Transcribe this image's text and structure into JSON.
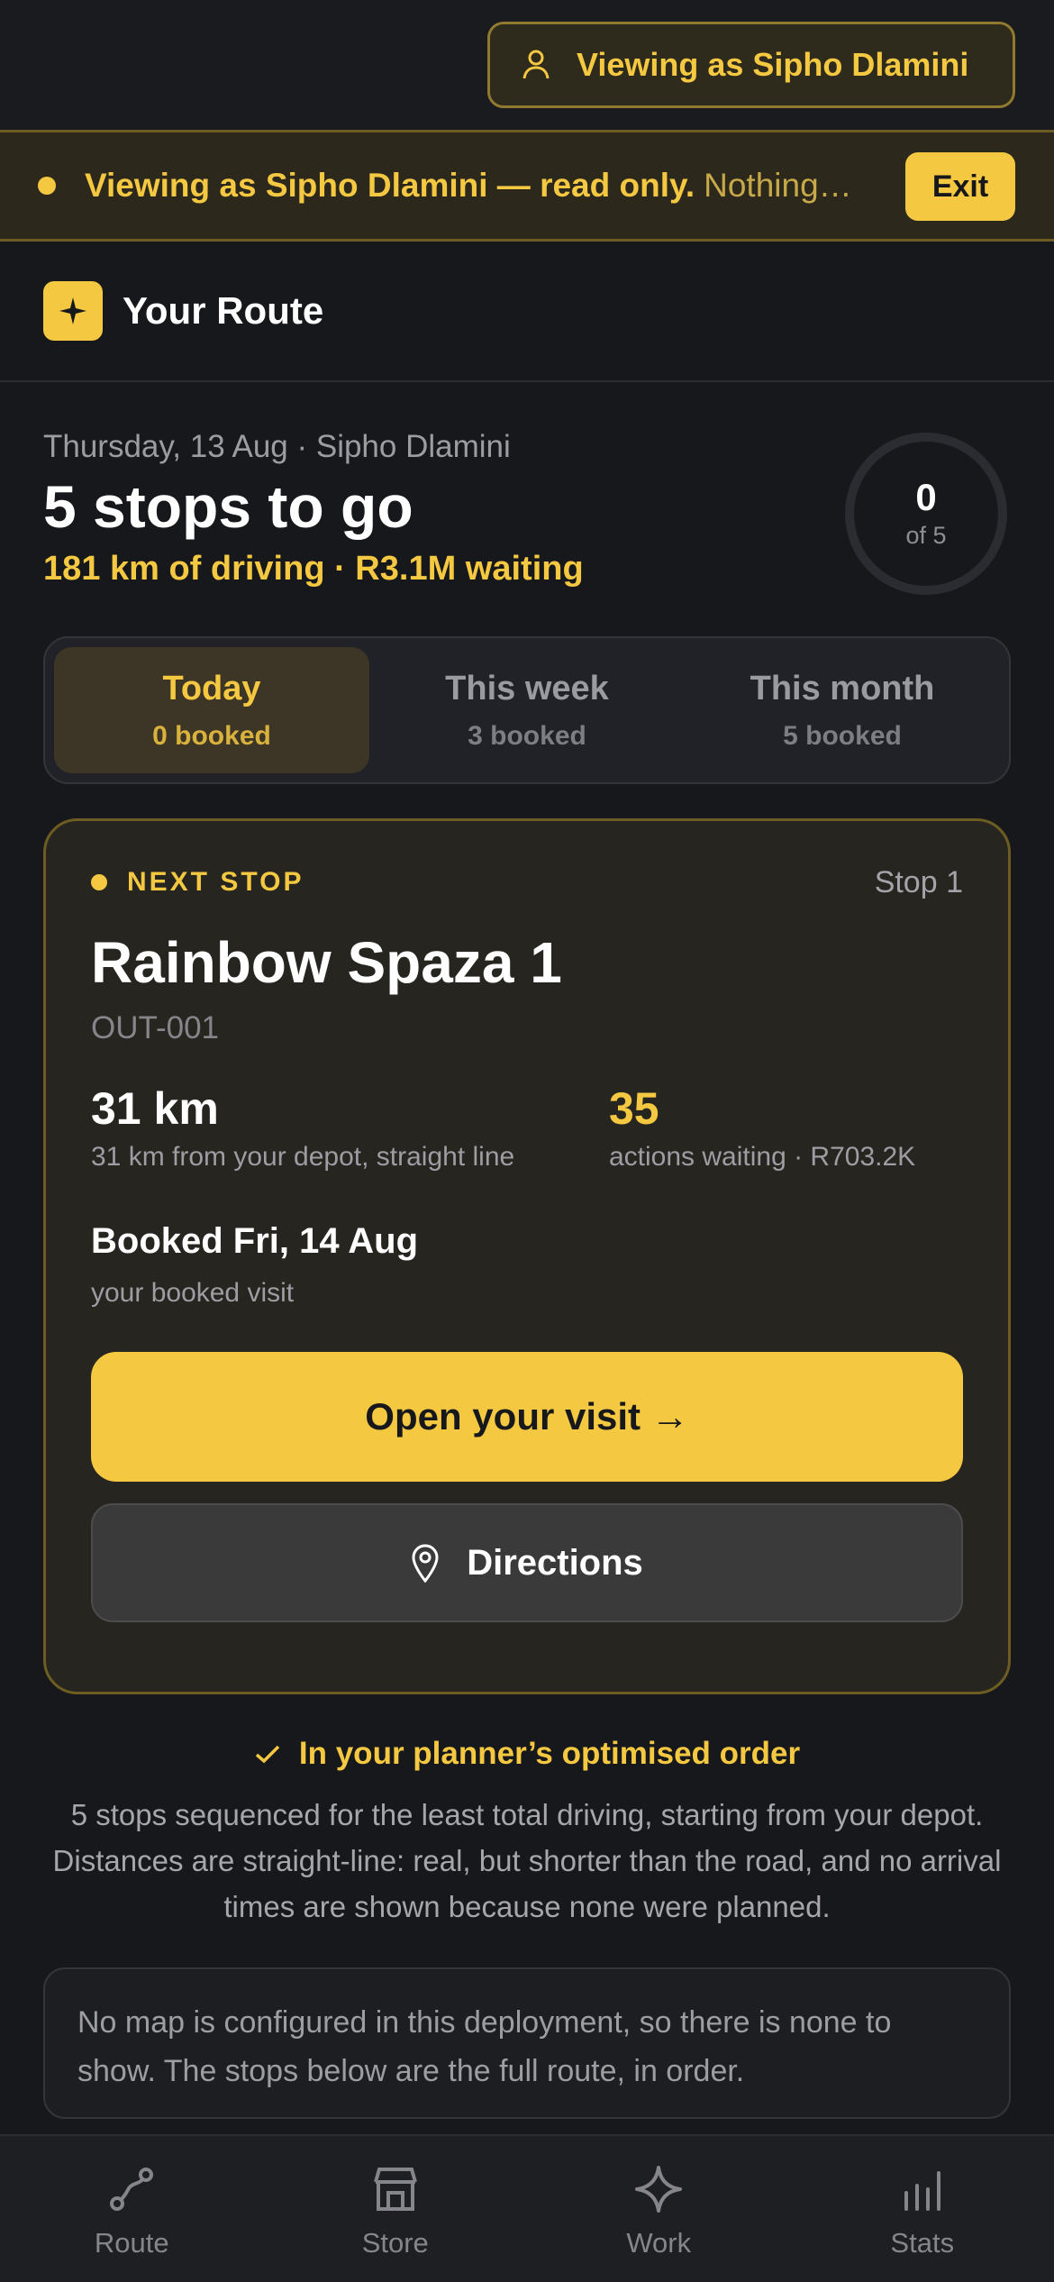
{
  "topbar": {
    "viewing_label": "Viewing as Sipho Dlamini",
    "icon": "user-icon"
  },
  "banner": {
    "bold_text": "Viewing as Sipho Dlamini — read only.",
    "dim_text": "Nothing you do here is saved.",
    "exit_label": "Exit"
  },
  "header": {
    "title": "Your Route",
    "icon": "compass-star-icon"
  },
  "summary": {
    "date_line": "Thursday, 13 Aug · Sipho Dlamini",
    "stops_line": "5 stops to go",
    "driving_line": "181 km of driving · R3.1M waiting",
    "progress_done": "0",
    "progress_total": "of 5"
  },
  "tabs": [
    {
      "label": "Today",
      "sub": "0 booked",
      "active": true
    },
    {
      "label": "This week",
      "sub": "3 booked",
      "active": false
    },
    {
      "label": "This month",
      "sub": "5 booked",
      "active": false
    }
  ],
  "next_stop": {
    "label": "NEXT STOP",
    "stop_number": "Stop 1",
    "store_name": "Rainbow Spaza 1",
    "store_code": "OUT-001",
    "distance_value": "31 km",
    "distance_caption": "31 km from your depot, straight line",
    "actions_value": "35",
    "actions_caption": "actions waiting · R703.2K",
    "booked_value": "Booked Fri, 14 Aug",
    "booked_caption": "your booked visit",
    "open_button": "Open your visit →",
    "directions_button": "Directions"
  },
  "optimised": {
    "title": "In your planner’s optimised order",
    "text": "5 stops sequenced for the least total driving, starting from your depot. Distances are straight-line: real, but shorter than the road, and no arrival times are shown because none were planned."
  },
  "map_note": "No map is configured in this deployment, so there is none to show. The stops below are the full route, in order.",
  "bottom_nav": [
    {
      "label": "Route",
      "icon": "route-icon"
    },
    {
      "label": "Store",
      "icon": "store-icon"
    },
    {
      "label": "Work",
      "icon": "sparkle-icon"
    },
    {
      "label": "Stats",
      "icon": "bar-chart-icon"
    }
  ],
  "colors": {
    "accent": "#f5c842",
    "background": "#17181c",
    "card": "#27251f"
  }
}
